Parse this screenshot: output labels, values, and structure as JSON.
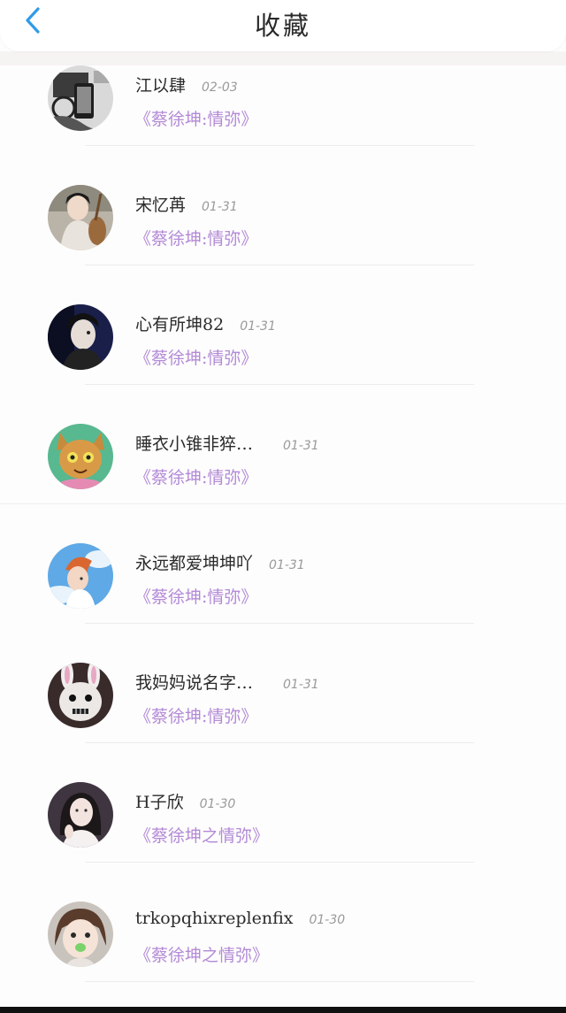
{
  "header": {
    "title": "收藏",
    "back_icon": "chevron-left-icon",
    "accent_color": "#2f9be8"
  },
  "list": [
    {
      "user": "江以肆",
      "date": "02-03",
      "title": "《蔡徐坤:情弥》",
      "avatar": "phone-photo"
    },
    {
      "user": "宋忆苒",
      "date": "01-31",
      "title": "《蔡徐坤:情弥》",
      "avatar": "costume-girl"
    },
    {
      "user": "心有所坤82",
      "date": "01-31",
      "title": "《蔡徐坤:情弥》",
      "avatar": "dark-portrait"
    },
    {
      "user": "睡衣小锥非猝…",
      "date": "01-31",
      "title": "《蔡徐坤:情弥》",
      "avatar": "cat-cartoon"
    },
    {
      "user": "永远都爱坤坤吖",
      "date": "01-31",
      "title": "《蔡徐坤:情弥》",
      "avatar": "anime-boy"
    },
    {
      "user": "我妈妈说名字…",
      "date": "01-31",
      "title": "《蔡徐坤:情弥》",
      "avatar": "rabbit-mask"
    },
    {
      "user": "H子欣",
      "date": "01-30",
      "title": "《蔡徐坤之情弥》",
      "avatar": "girl-portrait"
    },
    {
      "user": "trkopqhixreplenfix",
      "date": "01-30",
      "title": "《蔡徐坤之情弥》",
      "avatar": "child-portrait"
    }
  ],
  "colors": {
    "title_link": "#b38ad6",
    "date": "#9a9a9a"
  }
}
